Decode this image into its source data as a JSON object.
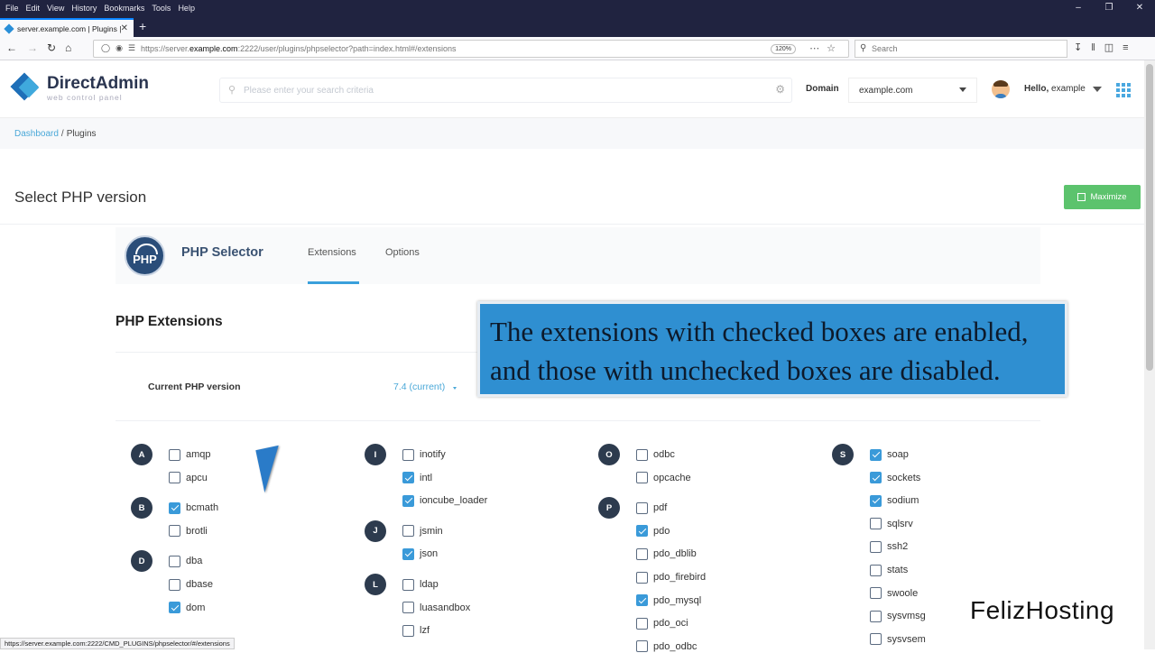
{
  "browser": {
    "menu": [
      "File",
      "Edit",
      "View",
      "History",
      "Bookmarks",
      "Tools",
      "Help"
    ],
    "tab_title": "server.example.com | Plugins |",
    "url_prefix": "https://server.",
    "url_host": "example.com",
    "url_rest": ":2222/user/plugins/phpselector?path=index.html#/extensions",
    "zoom": "120%",
    "search_placeholder": "Search",
    "status_url": "https://server.example.com:2222/CMD_PLUGINS/phpselector/#/extensions"
  },
  "header": {
    "logo_title": "DirectAdmin",
    "logo_subtitle": "web control panel",
    "search_placeholder": "Please enter your search criteria",
    "domain_label": "Domain",
    "domain_value": "example.com",
    "hello_label": "Hello,",
    "hello_user": "example"
  },
  "breadcrumb": {
    "home": "Dashboard",
    "separator": "/",
    "current": "Plugins"
  },
  "page": {
    "title": "Select PHP version",
    "maximize_label": "Maximize"
  },
  "plugin": {
    "logo_text": "PHP",
    "title": "PHP Selector",
    "tabs": [
      "Extensions",
      "Options"
    ],
    "active_tab": "Extensions"
  },
  "extensions": {
    "heading": "PHP Extensions",
    "current_label": "Current PHP version",
    "current_value": "7.4 (current)",
    "groups": [
      {
        "letter": "A",
        "items": [
          {
            "name": "amqp",
            "on": false
          },
          {
            "name": "apcu",
            "on": false
          }
        ]
      },
      {
        "letter": "B",
        "items": [
          {
            "name": "bcmath",
            "on": true
          },
          {
            "name": "brotli",
            "on": false
          }
        ]
      },
      {
        "letter": "D",
        "items": [
          {
            "name": "dba",
            "on": false
          },
          {
            "name": "dbase",
            "on": false
          },
          {
            "name": "dom",
            "on": true
          }
        ]
      },
      {
        "letter": "I",
        "items": [
          {
            "name": "inotify",
            "on": false
          },
          {
            "name": "intl",
            "on": true
          },
          {
            "name": "ioncube_loader",
            "on": true
          }
        ]
      },
      {
        "letter": "J",
        "items": [
          {
            "name": "jsmin",
            "on": false
          },
          {
            "name": "json",
            "on": true
          }
        ]
      },
      {
        "letter": "L",
        "items": [
          {
            "name": "ldap",
            "on": false
          },
          {
            "name": "luasandbox",
            "on": false
          },
          {
            "name": "lzf",
            "on": false
          }
        ]
      },
      {
        "letter": "O",
        "items": [
          {
            "name": "odbc",
            "on": false
          },
          {
            "name": "opcache",
            "on": false
          }
        ]
      },
      {
        "letter": "P",
        "items": [
          {
            "name": "pdf",
            "on": false
          },
          {
            "name": "pdo",
            "on": true
          },
          {
            "name": "pdo_dblib",
            "on": false
          },
          {
            "name": "pdo_firebird",
            "on": false
          },
          {
            "name": "pdo_mysql",
            "on": true
          },
          {
            "name": "pdo_oci",
            "on": false
          },
          {
            "name": "pdo_odbc",
            "on": false
          }
        ]
      },
      {
        "letter": "S",
        "items": [
          {
            "name": "soap",
            "on": true
          },
          {
            "name": "sockets",
            "on": true
          },
          {
            "name": "sodium",
            "on": true
          },
          {
            "name": "sqlsrv",
            "on": false
          },
          {
            "name": "ssh2",
            "on": false
          },
          {
            "name": "stats",
            "on": false
          },
          {
            "name": "swoole",
            "on": false
          },
          {
            "name": "sysvmsg",
            "on": false
          },
          {
            "name": "sysvsem",
            "on": false
          }
        ]
      }
    ]
  },
  "overlay": {
    "line1": "The extensions with checked boxes are enabled,",
    "line2": "and those with unchecked boxes are disabled."
  },
  "watermark": "FelizHosting",
  "colors": {
    "accent": "#3a9ad9",
    "maximize": "#5cc36d",
    "overlay_bg": "#2f8fd1",
    "letter_badge": "#2d3b4e",
    "menubar": "#202340"
  }
}
